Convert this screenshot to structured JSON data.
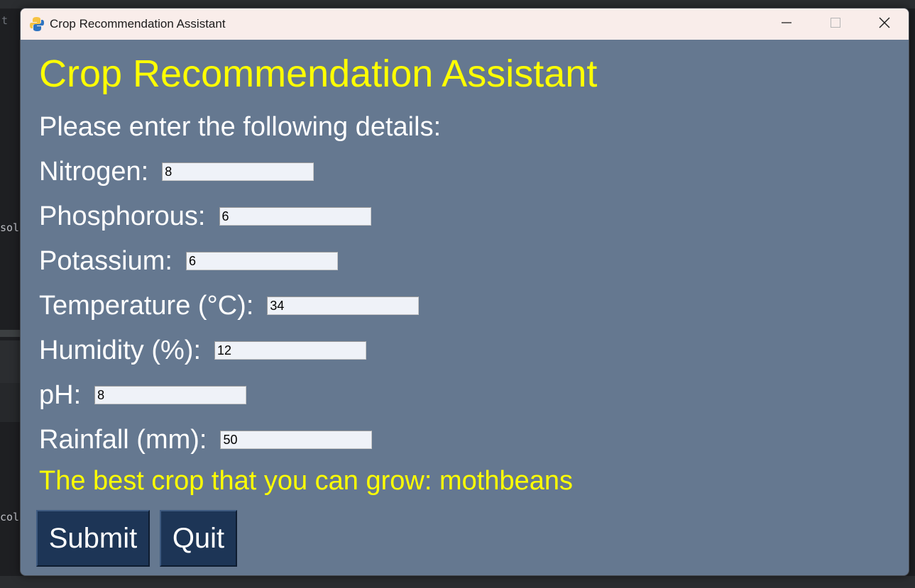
{
  "window": {
    "title": "Crop Recommendation Assistant"
  },
  "heading": "Crop Recommendation Assistant",
  "subheading": "Please enter the following details:",
  "fields": [
    {
      "label": "Nitrogen:",
      "value": "8"
    },
    {
      "label": "Phosphorous:",
      "value": "6"
    },
    {
      "label": "Potassium:",
      "value": "6"
    },
    {
      "label": "Temperature (°C):",
      "value": "34"
    },
    {
      "label": "Humidity (%):",
      "value": "12"
    },
    {
      "label": "pH:",
      "value": "8"
    },
    {
      "label": "Rainfall (mm):",
      "value": "50"
    }
  ],
  "result": "The best crop that you can grow: mothbeans",
  "buttons": {
    "submit": "Submit",
    "quit": "Quit"
  },
  "background": {
    "console_text": "sole",
    "col_text": "col",
    "t_text": "t"
  },
  "colors": {
    "window_bg": "#657890",
    "heading": "#ffff00",
    "label": "#ffffff",
    "button_bg": "#1d3556",
    "titlebar_bg": "#f9edea"
  },
  "icons": {
    "app": "python-icon",
    "minimize": "minimize-icon",
    "maximize": "maximize-icon",
    "close": "close-icon"
  }
}
